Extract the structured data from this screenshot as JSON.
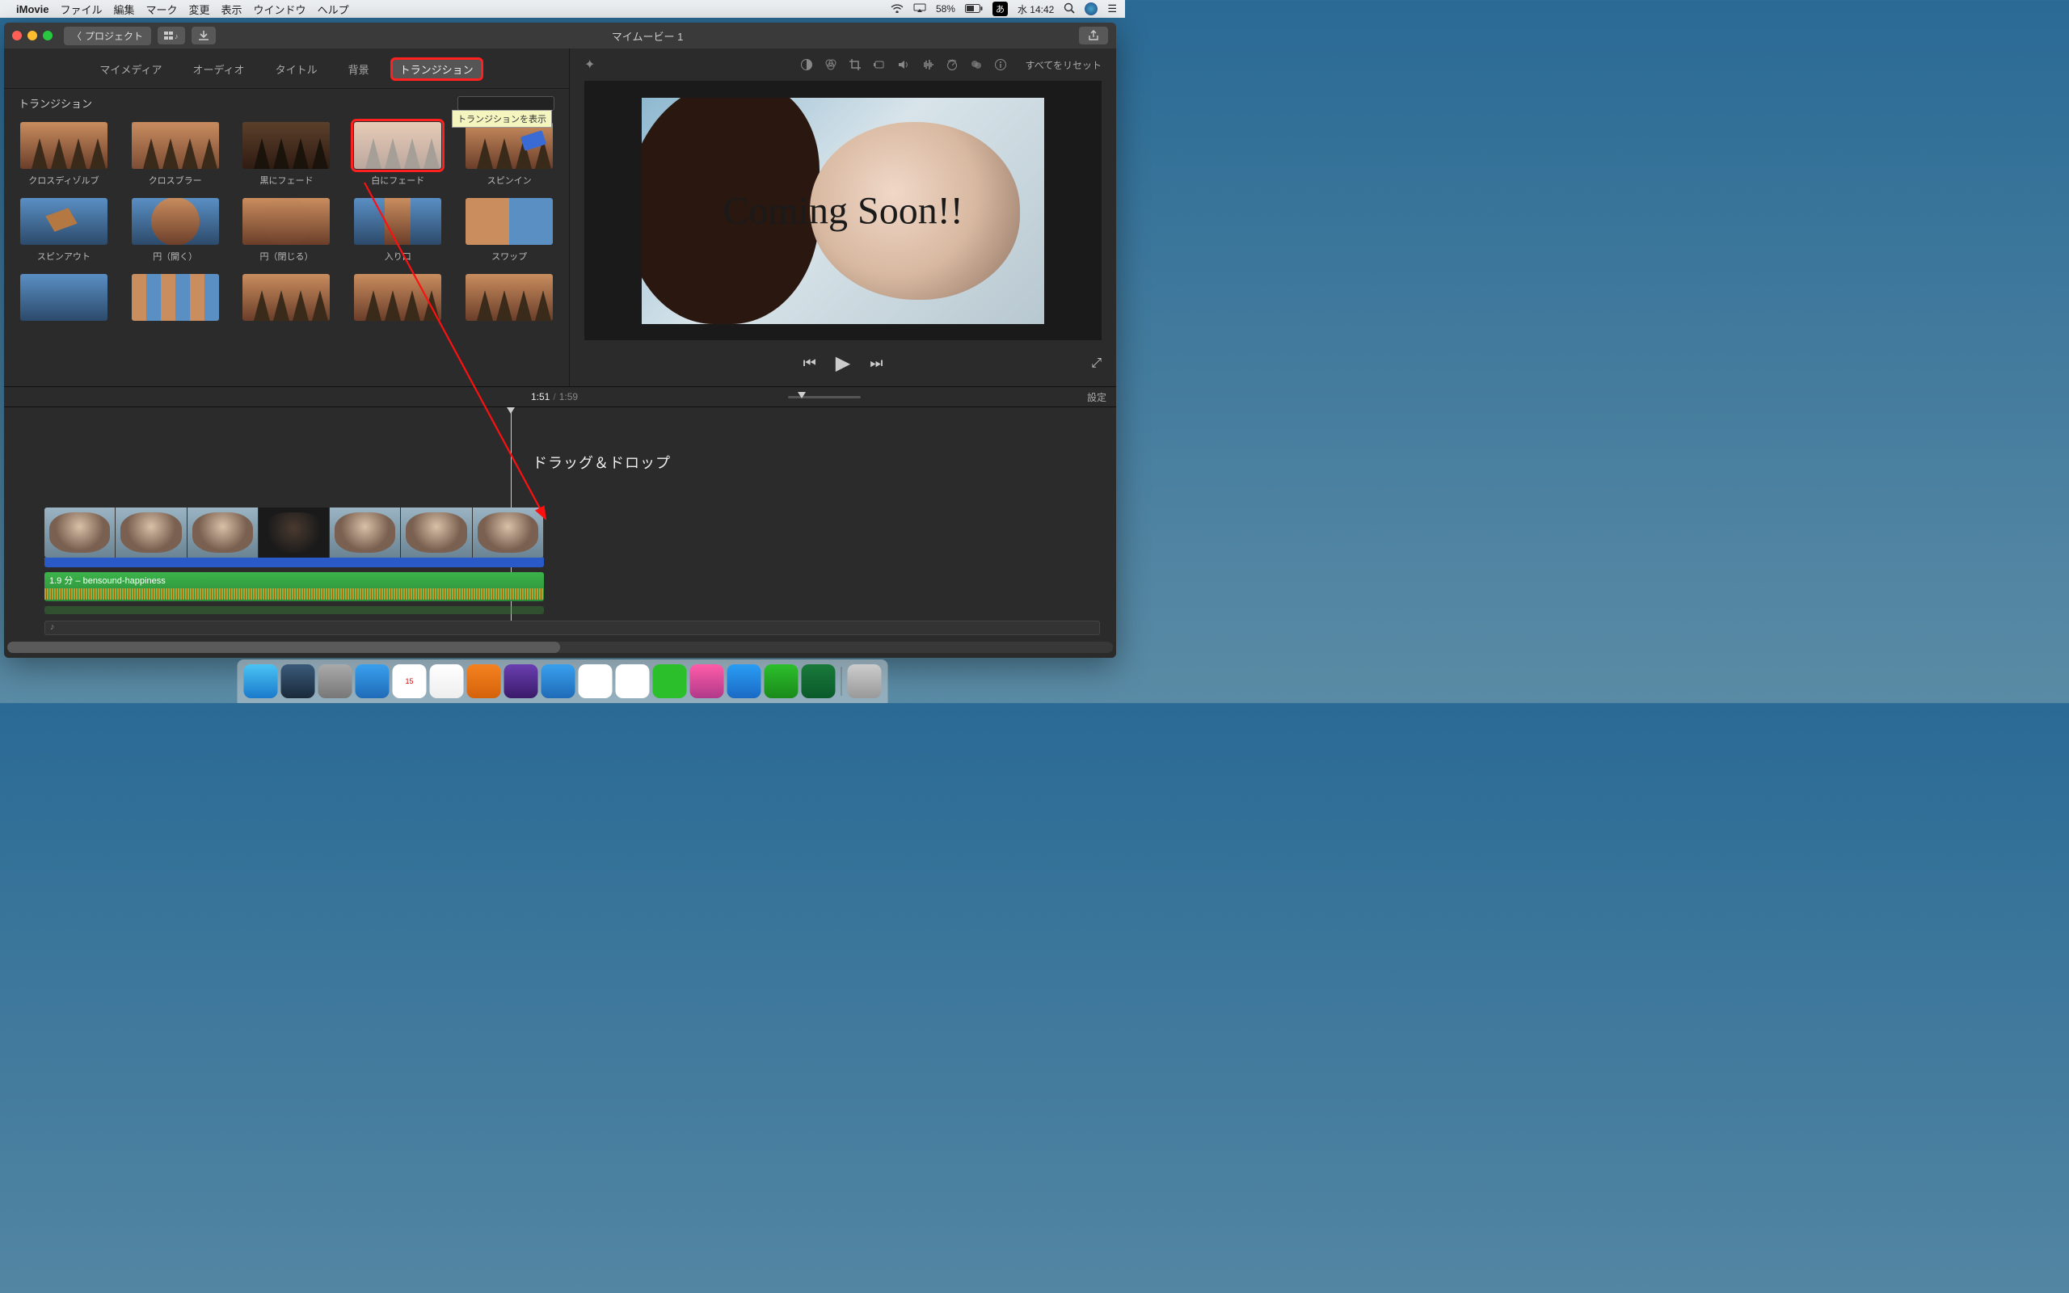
{
  "menubar": {
    "app": "iMovie",
    "items": [
      "ファイル",
      "編集",
      "マーク",
      "変更",
      "表示",
      "ウインドウ",
      "ヘルプ"
    ],
    "battery_pct": "58%",
    "ime": "あ",
    "clock": "水 14:42"
  },
  "titlebar": {
    "back": "プロジェクト",
    "title": "マイムービー 1"
  },
  "mediaTabs": [
    "マイメディア",
    "オーディオ",
    "タイトル",
    "背景",
    "トランジション"
  ],
  "browserHeader": "トランジション",
  "tooltip": "トランジションを表示",
  "transitions": [
    {
      "label": "クロスディゾルブ",
      "variant": "forest"
    },
    {
      "label": "クロスブラー",
      "variant": "forest-blur"
    },
    {
      "label": "黒にフェード",
      "variant": "forest-black"
    },
    {
      "label": "白にフェード",
      "variant": "forest-white",
      "highlight": true
    },
    {
      "label": "スピンイン",
      "variant": "forest-card"
    },
    {
      "label": "スピンアウト",
      "variant": "blue-cube"
    },
    {
      "label": "円（開く）",
      "variant": "blue-circle"
    },
    {
      "label": "円（閉じる）",
      "variant": "forest-circle"
    },
    {
      "label": "入り口",
      "variant": "split-narrow"
    },
    {
      "label": "スワップ",
      "variant": "split-two"
    },
    {
      "label": "",
      "variant": "blue"
    },
    {
      "label": "",
      "variant": "mosaic"
    },
    {
      "label": "",
      "variant": "forest"
    },
    {
      "label": "",
      "variant": "forest"
    },
    {
      "label": "",
      "variant": "forest"
    }
  ],
  "viewerToolbar": {
    "reset": "すべてをリセット"
  },
  "preview": {
    "overlay_text": "Coming Soon!!"
  },
  "timeInfo": {
    "current": "1:51",
    "total": "1:59",
    "settings": "設定"
  },
  "annotation": "ドラッグ＆ドロップ",
  "audio": {
    "label": "1.9 分 – bensound-happiness"
  },
  "dockApps": [
    "finder",
    "safari-alt",
    "launchpad",
    "safari",
    "calendar",
    "reminders",
    "vlc",
    "imovie",
    "safari2",
    "chrome",
    "chrome2",
    "line",
    "itunes",
    "appstore",
    "numbers",
    "excel",
    "trash"
  ]
}
